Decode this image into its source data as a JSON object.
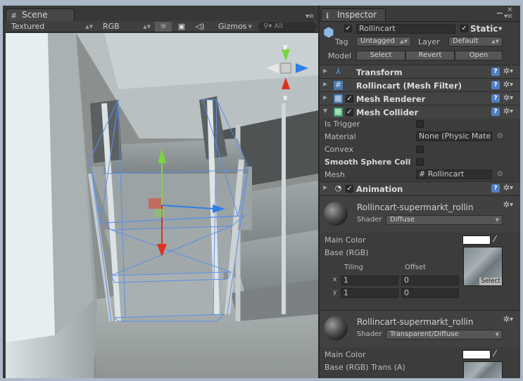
{
  "scene": {
    "tab_label": "Scene",
    "toolbar": {
      "render_mode": "Textured",
      "color_mode": "RGB",
      "gizmos_label": "Gizmos",
      "search_placeholder": "All"
    },
    "gizmo_labels": {
      "y": "y",
      "x": "x"
    }
  },
  "inspector": {
    "tab_label": "Inspector",
    "object": {
      "name": "Rollincart",
      "active": true,
      "static_label": "Static",
      "static": true,
      "tag_label": "Tag",
      "tag_value": "Untagged",
      "layer_label": "Layer",
      "layer_value": "Default",
      "model_label": "Model",
      "model_buttons": {
        "select": "Select",
        "revert": "Revert",
        "open": "Open"
      }
    },
    "components": {
      "transform": {
        "title": "Transform"
      },
      "mesh_filter": {
        "title": "Rollincart (Mesh Filter)"
      },
      "mesh_renderer": {
        "title": "Mesh Renderer",
        "enabled": true
      },
      "mesh_collider": {
        "title": "Mesh Collider",
        "enabled": true,
        "is_trigger_label": "Is Trigger",
        "material_label": "Material",
        "material_value": "None (Physic Mate",
        "convex_label": "Convex",
        "smooth_label": "Smooth Sphere Coll",
        "mesh_label": "Mesh",
        "mesh_value": "Rollincart"
      },
      "animation": {
        "title": "Animation",
        "enabled": true
      }
    },
    "materials": [
      {
        "name": "Rollincart-supermarkt_rollin",
        "shader_label": "Shader",
        "shader_value": "Diffuse",
        "main_color_label": "Main Color",
        "base_label": "Base (RGB)",
        "tiling_label": "Tiling",
        "offset_label": "Offset",
        "x_label": "x",
        "y_label": "y",
        "tiling_x": "1",
        "tiling_y": "1",
        "offset_x": "0",
        "offset_y": "0",
        "select_label": "Select",
        "main_color": "#ffffff"
      },
      {
        "name": "Rollincart-supermarkt_rollin",
        "shader_label": "Shader",
        "shader_value": "Transparent/Diffuse",
        "main_color_label": "Main Color",
        "base_label": "Base (RGB) Trans (A)",
        "main_color": "#ffffff"
      }
    ]
  },
  "colors": {
    "gizmo_y": "#7dd63a",
    "gizmo_x": "#e0301e",
    "gizmo_z": "#2e7fe8",
    "selection_wire": "#5b8fe8"
  }
}
